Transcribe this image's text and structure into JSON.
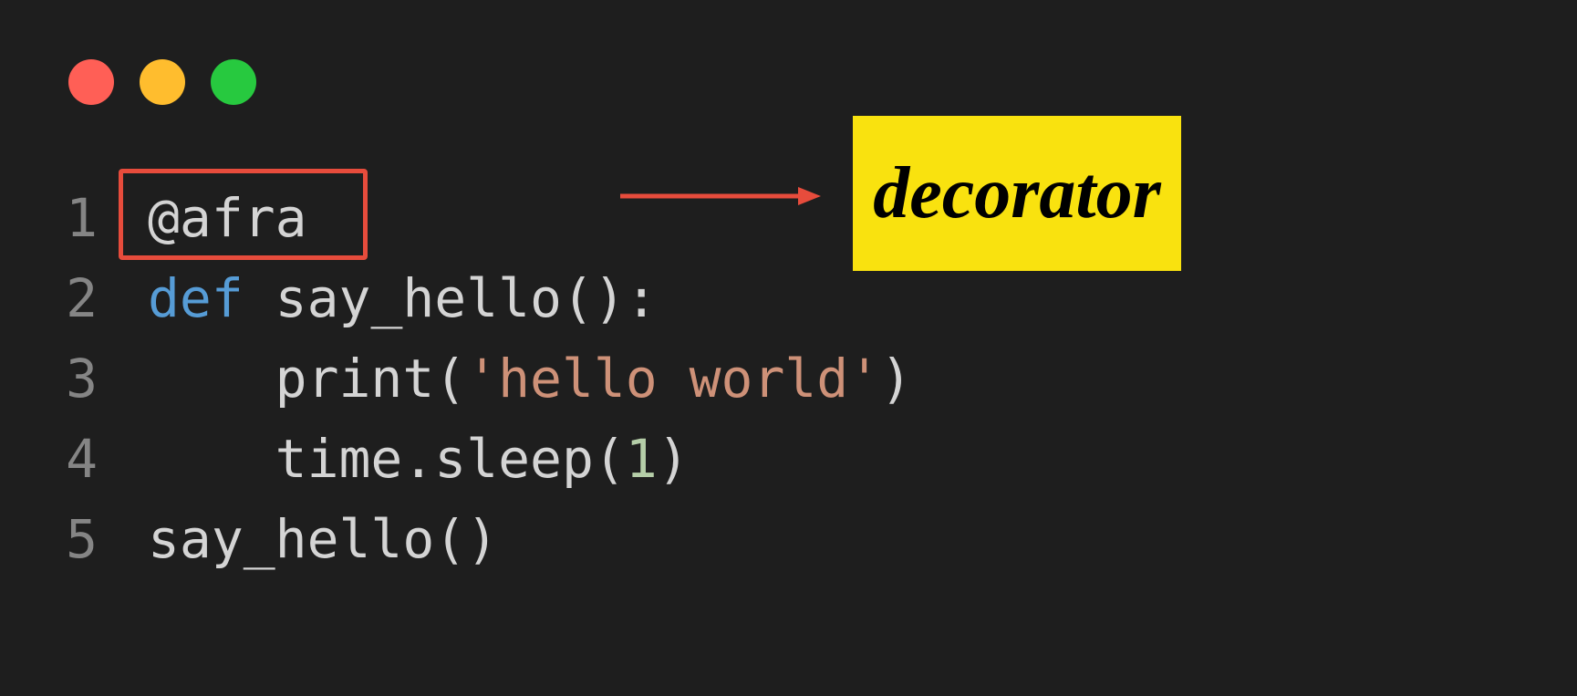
{
  "window": {
    "colors": {
      "red": "#ff5f56",
      "yellow": "#ffbd2e",
      "green": "#27c93f"
    }
  },
  "annotation": {
    "label": "decorator",
    "highlight_color": "#e74c3c",
    "label_bg": "#f9e20f"
  },
  "code": {
    "lines": [
      {
        "num": "1",
        "tokens": [
          {
            "t": "@afra",
            "c": "default"
          }
        ]
      },
      {
        "num": "2",
        "tokens": [
          {
            "t": "def",
            "c": "keyword"
          },
          {
            "t": " say_hello():",
            "c": "default"
          }
        ]
      },
      {
        "num": "3",
        "tokens": [
          {
            "t": "    print(",
            "c": "default"
          },
          {
            "t": "'hello world'",
            "c": "string"
          },
          {
            "t": ")",
            "c": "default"
          }
        ]
      },
      {
        "num": "4",
        "tokens": [
          {
            "t": "    time.sleep(",
            "c": "default"
          },
          {
            "t": "1",
            "c": "number-lit"
          },
          {
            "t": ")",
            "c": "default"
          }
        ]
      },
      {
        "num": "5",
        "tokens": [
          {
            "t": "say_hello()",
            "c": "default"
          }
        ]
      }
    ]
  }
}
